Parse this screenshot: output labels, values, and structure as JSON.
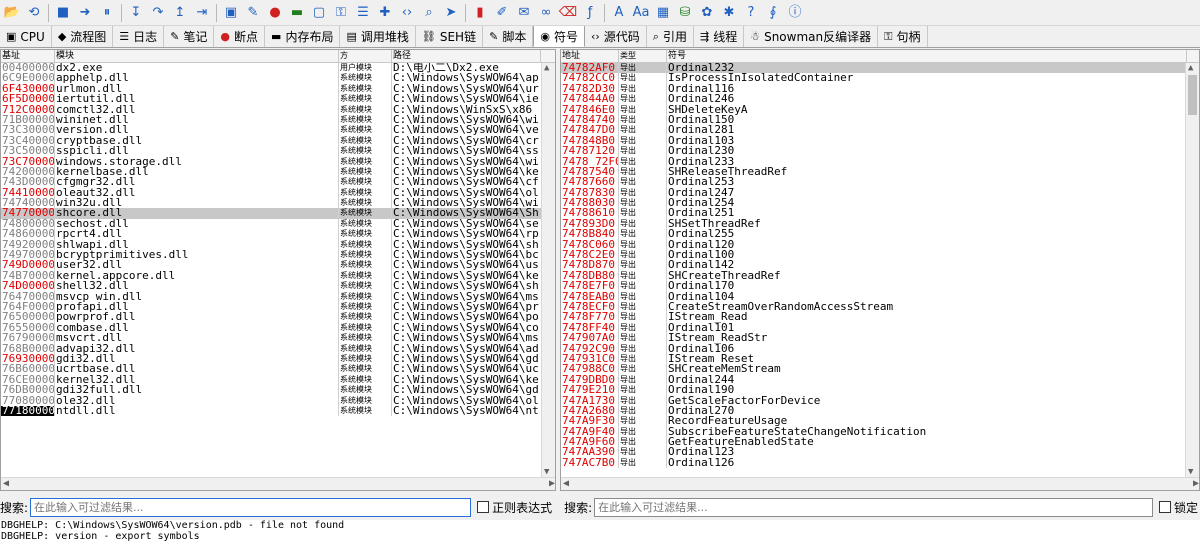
{
  "toolbar": {
    "icons": [
      "open-icon",
      "restart-icon",
      "close-icon",
      "run-icon",
      "pause-icon",
      "step-into-icon",
      "step-over-icon",
      "step-out-icon",
      "run-to-user-icon",
      "cpu-view-icon",
      "script-icon",
      "breakpoint-icon",
      "memory-icon",
      "window-icon",
      "handles-icon",
      "log-icon",
      "patch-icon",
      "code-icon",
      "search-icon",
      "trace-icon",
      "hide-icon",
      "highlighter-icon",
      "comment-icon",
      "link-icon",
      "erase-icon",
      "formula-icon",
      "font-icon",
      "text-size-icon",
      "calculator-icon",
      "database-icon",
      "color-palette-icon",
      "bug-icon",
      "help-icon",
      "exec-icon",
      "info-icon"
    ]
  },
  "tabs": [
    {
      "label": "CPU",
      "icon": "cpu-icon"
    },
    {
      "label": "流程图",
      "icon": "flowchart-icon"
    },
    {
      "label": "日志",
      "icon": "log-icon"
    },
    {
      "label": "笔记",
      "icon": "notes-icon"
    },
    {
      "label": "断点",
      "icon": "breakpoint-icon"
    },
    {
      "label": "内存布局",
      "icon": "memory-map-icon"
    },
    {
      "label": "调用堆栈",
      "icon": "call-stack-icon"
    },
    {
      "label": "SEH链",
      "icon": "seh-icon"
    },
    {
      "label": "脚本",
      "icon": "script-icon"
    },
    {
      "label": "符号",
      "icon": "symbols-icon"
    },
    {
      "label": "源代码",
      "icon": "source-icon"
    },
    {
      "label": "引用",
      "icon": "references-icon"
    },
    {
      "label": "线程",
      "icon": "threads-icon"
    },
    {
      "label": "Snowman反编译器",
      "icon": "snowman-icon"
    },
    {
      "label": "句柄",
      "icon": "handles-icon"
    }
  ],
  "active_tab": "符号",
  "modules": {
    "headers": {
      "base": "基址",
      "module": "模块",
      "party": "方",
      "path": "路径"
    },
    "rows": [
      {
        "base": "00400000",
        "name": "dx2.exe",
        "party": "用户模块",
        "path": "D:\\电小二\\Dx2.exe",
        "red": false
      },
      {
        "base": "6C9E0000",
        "name": "apphelp.dll",
        "party": "系统模块",
        "path": "C:\\Windows\\SysWOW64\\ap",
        "red": false
      },
      {
        "base": "6F430000",
        "name": "urlmon.dll",
        "party": "系统模块",
        "path": "C:\\Windows\\SysWOW64\\ur",
        "red": true
      },
      {
        "base": "6F5D0000",
        "name": "iertutil.dll",
        "party": "系统模块",
        "path": "C:\\Windows\\SysWOW64\\ie",
        "red": true
      },
      {
        "base": "712C0000",
        "name": "comctl32.dll",
        "party": "系统模块",
        "path": "C:\\Windows\\WinSxS\\x86_",
        "red": true
      },
      {
        "base": "71B00000",
        "name": "wininet.dll",
        "party": "系统模块",
        "path": "C:\\Windows\\SysWOW64\\wi",
        "red": false
      },
      {
        "base": "73C30000",
        "name": "version.dll",
        "party": "系统模块",
        "path": "C:\\Windows\\SysWOW64\\ve",
        "red": false
      },
      {
        "base": "73C40000",
        "name": "cryptbase.dll",
        "party": "系统模块",
        "path": "C:\\Windows\\SysWOW64\\cr",
        "red": false
      },
      {
        "base": "73C50000",
        "name": "sspicli.dll",
        "party": "系统模块",
        "path": "C:\\Windows\\SysWOW64\\ss",
        "red": false
      },
      {
        "base": "73C70000",
        "name": "windows.storage.dll",
        "party": "系统模块",
        "path": "C:\\Windows\\SysWOW64\\wi",
        "red": true
      },
      {
        "base": "74200000",
        "name": "kernelbase.dll",
        "party": "系统模块",
        "path": "C:\\Windows\\SysWOW64\\ke",
        "red": false
      },
      {
        "base": "743D0000",
        "name": "cfgmgr32.dll",
        "party": "系统模块",
        "path": "C:\\Windows\\SysWOW64\\cf",
        "red": false
      },
      {
        "base": "74410000",
        "name": "oleaut32.dll",
        "party": "系统模块",
        "path": "C:\\Windows\\SysWOW64\\ol",
        "red": true
      },
      {
        "base": "74740000",
        "name": "win32u.dll",
        "party": "系统模块",
        "path": "C:\\Windows\\SysWOW64\\wi",
        "red": false
      },
      {
        "base": "74770000",
        "name": "shcore.dll",
        "party": "系统模块",
        "path": "C:\\Windows\\SysWOW64\\Sh",
        "red": true,
        "selected": true
      },
      {
        "base": "74800000",
        "name": "sechost.dll",
        "party": "系统模块",
        "path": "C:\\Windows\\SysWOW64\\se",
        "red": false
      },
      {
        "base": "74860000",
        "name": "rpcrt4.dll",
        "party": "系统模块",
        "path": "C:\\Windows\\SysWOW64\\rp",
        "red": false
      },
      {
        "base": "74920000",
        "name": "shlwapi.dll",
        "party": "系统模块",
        "path": "C:\\Windows\\SysWOW64\\sh",
        "red": false
      },
      {
        "base": "74970000",
        "name": "bcryptprimitives.dll",
        "party": "系统模块",
        "path": "C:\\Windows\\SysWOW64\\bc",
        "red": false
      },
      {
        "base": "749D0000",
        "name": "user32.dll",
        "party": "系统模块",
        "path": "C:\\Windows\\SysWOW64\\us",
        "red": true
      },
      {
        "base": "74B70000",
        "name": "kernel.appcore.dll",
        "party": "系统模块",
        "path": "C:\\Windows\\SysWOW64\\ke",
        "red": false
      },
      {
        "base": "74D00000",
        "name": "shell32.dll",
        "party": "系统模块",
        "path": "C:\\Windows\\SysWOW64\\sh",
        "red": true
      },
      {
        "base": "76470000",
        "name": "msvcp_win.dll",
        "party": "系统模块",
        "path": "C:\\Windows\\SysWOW64\\ms",
        "red": false
      },
      {
        "base": "764F0000",
        "name": "profapi.dll",
        "party": "系统模块",
        "path": "C:\\Windows\\SysWOW64\\pr",
        "red": false
      },
      {
        "base": "76500000",
        "name": "powrprof.dll",
        "party": "系统模块",
        "path": "C:\\Windows\\SysWOW64\\po",
        "red": false
      },
      {
        "base": "76550000",
        "name": "combase.dll",
        "party": "系统模块",
        "path": "C:\\Windows\\SysWOW64\\co",
        "red": false
      },
      {
        "base": "76790000",
        "name": "msvcrt.dll",
        "party": "系统模块",
        "path": "C:\\Windows\\SysWOW64\\ms",
        "red": false
      },
      {
        "base": "768B0000",
        "name": "advapi32.dll",
        "party": "系统模块",
        "path": "C:\\Windows\\SysWOW64\\ad",
        "red": false
      },
      {
        "base": "76930000",
        "name": "gdi32.dll",
        "party": "系统模块",
        "path": "C:\\Windows\\SysWOW64\\gd",
        "red": true
      },
      {
        "base": "76B60000",
        "name": "ucrtbase.dll",
        "party": "系统模块",
        "path": "C:\\Windows\\SysWOW64\\uc",
        "red": false
      },
      {
        "base": "76CE0000",
        "name": "kernel32.dll",
        "party": "系统模块",
        "path": "C:\\Windows\\SysWOW64\\ke",
        "red": false
      },
      {
        "base": "76DB0000",
        "name": "gdi32full.dll",
        "party": "系统模块",
        "path": "C:\\Windows\\SysWOW64\\gd",
        "red": false
      },
      {
        "base": "77080000",
        "name": "ole32.dll",
        "party": "系统模块",
        "path": "C:\\Windows\\SysWOW64\\ol",
        "red": false
      },
      {
        "base": "77180000",
        "name": "ntdll.dll",
        "party": "系统模块",
        "path": "C:\\Windows\\SysWOW64\\nt",
        "red": false,
        "current": true
      }
    ]
  },
  "symbols": {
    "headers": {
      "address": "地址",
      "type": "类型",
      "symbol": "符号"
    },
    "rows": [
      {
        "addr": "74782AF0",
        "type": "导出",
        "sym": "Ordinal232",
        "selected": true
      },
      {
        "addr": "74782CC0",
        "type": "导出",
        "sym": "IsProcessInIsolatedContainer"
      },
      {
        "addr": "74782D30",
        "type": "导出",
        "sym": "Ordinal116"
      },
      {
        "addr": "747844A0",
        "type": "导出",
        "sym": "Ordinal246"
      },
      {
        "addr": "747846E0",
        "type": "导出",
        "sym": "SHDeleteKeyA"
      },
      {
        "addr": "74784740",
        "type": "导出",
        "sym": "Ordinal150"
      },
      {
        "addr": "747847D0",
        "type": "导出",
        "sym": "Ordinal281"
      },
      {
        "addr": "747848B0",
        "type": "导出",
        "sym": "Ordinal103"
      },
      {
        "addr": "74787120",
        "type": "导出",
        "sym": "Ordinal230"
      },
      {
        "addr": "7478 72F0",
        "type": "导出",
        "sym": "Ordinal233"
      },
      {
        "addr": "74787540",
        "type": "导出",
        "sym": "SHReleaseThreadRef"
      },
      {
        "addr": "74787660",
        "type": "导出",
        "sym": "Ordinal253"
      },
      {
        "addr": "74787830",
        "type": "导出",
        "sym": "Ordinal247"
      },
      {
        "addr": "74788030",
        "type": "导出",
        "sym": "Ordinal254"
      },
      {
        "addr": "74788610",
        "type": "导出",
        "sym": "Ordinal251"
      },
      {
        "addr": "747893D0",
        "type": "导出",
        "sym": "SHSetThreadRef"
      },
      {
        "addr": "7478B840",
        "type": "导出",
        "sym": "Ordinal255"
      },
      {
        "addr": "7478C060",
        "type": "导出",
        "sym": "Ordinal120"
      },
      {
        "addr": "7478C2E0",
        "type": "导出",
        "sym": "Ordinal100"
      },
      {
        "addr": "7478D870",
        "type": "导出",
        "sym": "Ordinal142"
      },
      {
        "addr": "7478DB80",
        "type": "导出",
        "sym": "SHCreateThreadRef"
      },
      {
        "addr": "7478E7F0",
        "type": "导出",
        "sym": "Ordinal170"
      },
      {
        "addr": "7478EAB0",
        "type": "导出",
        "sym": "Ordinal104"
      },
      {
        "addr": "7478ECF0",
        "type": "导出",
        "sym": "CreateStreamOverRandomAccessStream"
      },
      {
        "addr": "7478F770",
        "type": "导出",
        "sym": "IStream_Read"
      },
      {
        "addr": "7478FF40",
        "type": "导出",
        "sym": "Ordinal101"
      },
      {
        "addr": "747907A0",
        "type": "导出",
        "sym": "IStream_ReadStr"
      },
      {
        "addr": "74792C90",
        "type": "导出",
        "sym": "Ordinal106"
      },
      {
        "addr": "747931C0",
        "type": "导出",
        "sym": "IStream_Reset"
      },
      {
        "addr": "747988C0",
        "type": "导出",
        "sym": "SHCreateMemStream"
      },
      {
        "addr": "7479DBD0",
        "type": "导出",
        "sym": "Ordinal244"
      },
      {
        "addr": "7479E210",
        "type": "导出",
        "sym": "Ordinal190"
      },
      {
        "addr": "747A1730",
        "type": "导出",
        "sym": "GetScaleFactorForDevice"
      },
      {
        "addr": "747A2680",
        "type": "导出",
        "sym": "Ordinal270"
      },
      {
        "addr": "747A9F30",
        "type": "导出",
        "sym": "RecordFeatureUsage"
      },
      {
        "addr": "747A9F40",
        "type": "导出",
        "sym": "SubscribeFeatureStateChangeNotification"
      },
      {
        "addr": "747A9F60",
        "type": "导出",
        "sym": "GetFeatureEnabledState"
      },
      {
        "addr": "747AA390",
        "type": "导出",
        "sym": "Ordinal123"
      },
      {
        "addr": "747AC7B0",
        "type": "导出",
        "sym": "Ordinal126"
      }
    ]
  },
  "search": {
    "left_label": "搜索:",
    "left_placeholder": "在此输入可过滤结果...",
    "regex_label": "正则表达式",
    "right_label": "搜索:",
    "right_placeholder": "在此输入可过滤结果...",
    "lock_label": "锁定"
  },
  "log": {
    "lines": [
      "DBGHELP: C:\\Windows\\SysWOW64\\version.pdb - file not found",
      "DBGHELP: version - export symbols"
    ]
  },
  "colors": {
    "red_text": "#e00000",
    "selection": "#c8c8c8",
    "focus_border": "#2a6fd8"
  }
}
